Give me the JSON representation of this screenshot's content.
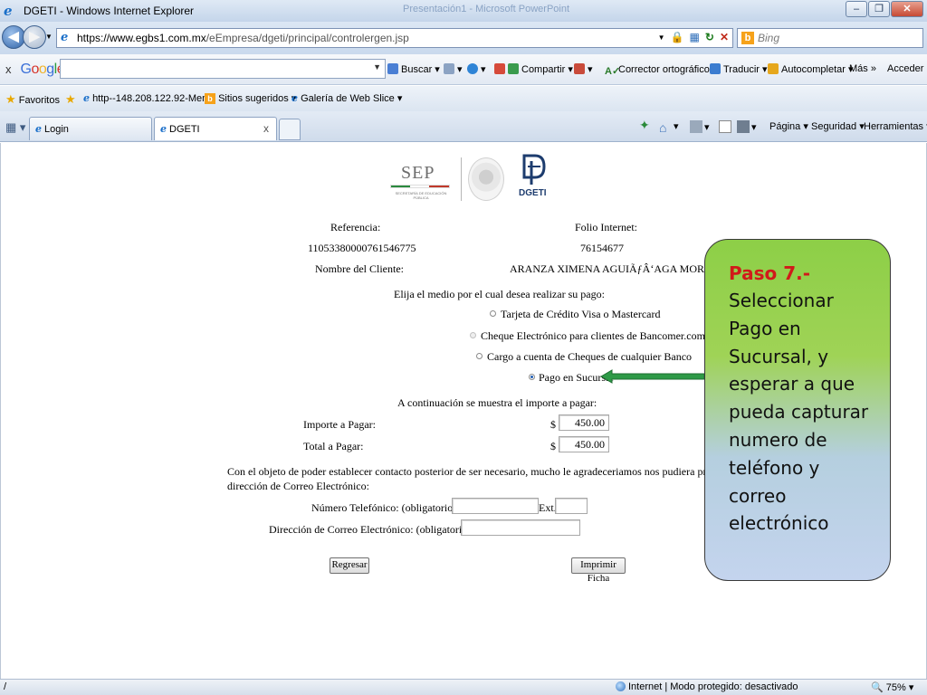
{
  "window": {
    "title": "DGETI - Windows Internet Explorer",
    "background_title": "Presentación1 - Microsoft PowerPoint"
  },
  "nav": {
    "url_host": "https://www.egbs1.com.mx",
    "url_path": "/eEmpresa/dgeti/principal/controlergen.jsp",
    "search_placeholder": "Bing"
  },
  "google_toolbar": {
    "logo": "Google",
    "buscar": "Buscar",
    "compartir": "Compartir",
    "corrector": "Corrector ortográfico",
    "traducir": "Traducir",
    "autocompletar": "Autocompletar",
    "mas": "Más",
    "acceder": "Acceder"
  },
  "favorites": {
    "label": "Favoritos",
    "item1": "http--148.208.122.92-Men...",
    "item2": "Sitios sugeridos",
    "item3": "Galería de Web Slice"
  },
  "tabs": [
    {
      "label": "Login"
    },
    {
      "label": "DGETI"
    }
  ],
  "command_bar": {
    "pagina": "Página",
    "seguridad": "Seguridad",
    "herramientas": "Herramientas"
  },
  "logos": {
    "sep": "SEP",
    "sep_sub": "SECRETARÍA DE EDUCACIÓN PÚBLICA",
    "dgeti": "DGETI"
  },
  "form": {
    "referencia_label": "Referencia:",
    "referencia_value": "11053380000761546775",
    "folio_label": "Folio Internet:",
    "folio_value": "76154677",
    "cliente_label": "Nombre del Cliente:",
    "cliente_value": "ARANZA XIMENA AGUIÃƒÂ‘AGA MORELOS",
    "medio_prompt": "Elija el medio por el cual desea realizar su pago:",
    "payment_options": [
      {
        "label": "Tarjeta de Crédito Visa o Mastercard",
        "checked": false,
        "disabled": false
      },
      {
        "label": "Cheque Electrónico para clientes de Bancomer.com",
        "checked": false,
        "disabled": true
      },
      {
        "label": "Cargo a cuenta de Cheques de cualquier Banco",
        "checked": false,
        "disabled": false
      },
      {
        "label": "Pago en Sucursal",
        "checked": true,
        "disabled": false
      }
    ],
    "importe_intro": "A continuación se muestra el importe a pagar:",
    "importe_label": "Importe a Pagar:",
    "total_label": "Total a Pagar:",
    "currency": "$",
    "importe_value": "450.00",
    "total_value": "450.00",
    "contact_line1": "Con el objeto de poder establecer contacto posterior de ser necesario, mucho le agradeceriamos nos pudiera proporcionar su Número Telefóni",
    "contact_line2": "dirección de Correo Electrónico:",
    "telefono_label": "Número Telefónico: (obligatorio)",
    "ext_label": "Ext.",
    "correo_label": "Dirección de Correo Electrónico: (obligatorio)",
    "telefono_value": "",
    "ext_value": "",
    "correo_value": "",
    "regresar": "Regresar",
    "imprimir": "Imprimir Ficha"
  },
  "callout": {
    "title": "Paso 7.-",
    "body": "Seleccionar Pago en Sucursal, y esperar a que pueda capturar numero de teléfono y correo electrónico",
    "title_color": "#d11a1a"
  },
  "status": {
    "left": "/",
    "zone": "Internet | Modo protegido: desactivado",
    "zoom": "75%"
  }
}
